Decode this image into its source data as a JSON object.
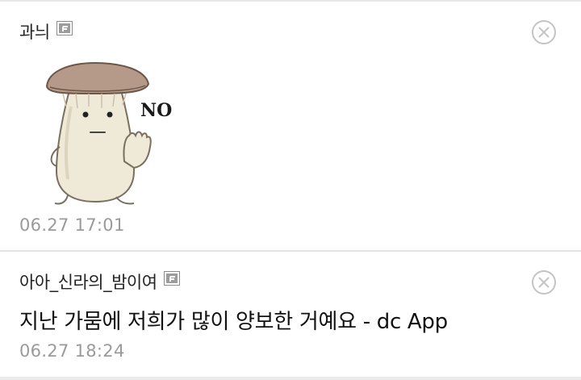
{
  "comments": [
    {
      "author": "과늬",
      "author_icon": "fixed-nick-icon",
      "sticker": {
        "caption": "NO",
        "icon": "mushroom-sticker"
      },
      "timestamp": "06.27 17:01"
    },
    {
      "author": "아아_신라의_밤이여",
      "author_icon": "fixed-nick-icon",
      "text": "지난 가뭄에 저희가 많이 양보한 거예요 - dc App",
      "timestamp": "06.27 18:24"
    }
  ],
  "colors": {
    "timestamp": "#9a9a9a",
    "divider": "#e3e3e3",
    "close_icon": "#c4c4c4"
  }
}
